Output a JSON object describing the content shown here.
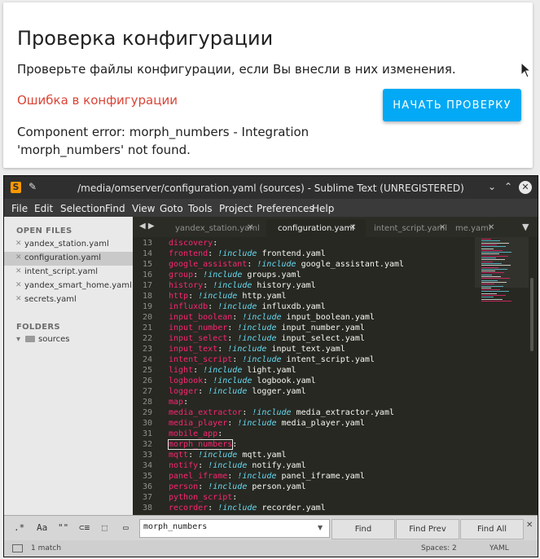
{
  "ha": {
    "title": "Проверка конфигурации",
    "description": "Проверьте файлы конфигурации, если Вы внесли в них изменения.",
    "error_title": "Ошибка в конфигурации",
    "error_message": "Component error: morph_numbers - Integration 'morph_numbers' not found.",
    "check_button": "НАЧАТЬ ПРОВЕРКУ"
  },
  "sublime": {
    "window_title": "/media/omserver/configuration.yaml (sources) - Sublime Text (UNREGISTERED)",
    "menu": [
      "File",
      "Edit",
      "Selection",
      "Find",
      "View",
      "Goto",
      "Tools",
      "Project",
      "Preferences",
      "Help"
    ],
    "sidebar": {
      "open_files_header": "OPEN FILES",
      "open_files": [
        "yandex_station.yaml",
        "configuration.yaml",
        "intent_script.yaml",
        "yandex_smart_home.yaml",
        "secrets.yaml"
      ],
      "active_file": "configuration.yaml",
      "folders_header": "FOLDERS",
      "folders": [
        "sources"
      ]
    },
    "tabs": [
      "yandex_station.yaml",
      "configuration.yaml",
      "intent_script.yaml",
      "me.yaml"
    ],
    "active_tab": "configuration.yaml",
    "lines": [
      {
        "n": "13",
        "key": "discovery",
        "inc": "",
        "val": ""
      },
      {
        "n": "14",
        "key": "frontend",
        "inc": "!include",
        "val": "frontend.yaml"
      },
      {
        "n": "15",
        "key": "google_assistant",
        "inc": "!include",
        "val": "google_assistant.yaml"
      },
      {
        "n": "16",
        "key": "group",
        "inc": "!include",
        "val": "groups.yaml"
      },
      {
        "n": "17",
        "key": "history",
        "inc": "!include",
        "val": "history.yaml"
      },
      {
        "n": "18",
        "key": "http",
        "inc": "!include",
        "val": "http.yaml"
      },
      {
        "n": "19",
        "key": "influxdb",
        "inc": "!include",
        "val": "influxdb.yaml"
      },
      {
        "n": "20",
        "key": "input_boolean",
        "inc": "!include",
        "val": "input_boolean.yaml"
      },
      {
        "n": "21",
        "key": "input_number",
        "inc": "!include",
        "val": "input_number.yaml"
      },
      {
        "n": "22",
        "key": "input_select",
        "inc": "!include",
        "val": "input_select.yaml"
      },
      {
        "n": "23",
        "key": "input_text",
        "inc": "!include",
        "val": "input_text.yaml"
      },
      {
        "n": "24",
        "key": "intent_script",
        "inc": "!include",
        "val": "intent_script.yaml"
      },
      {
        "n": "25",
        "key": "light",
        "inc": "!include",
        "val": "light.yaml"
      },
      {
        "n": "26",
        "key": "logbook",
        "inc": "!include",
        "val": "logbook.yaml"
      },
      {
        "n": "27",
        "key": "logger",
        "inc": "!include",
        "val": "logger.yaml"
      },
      {
        "n": "28",
        "key": "map",
        "inc": "",
        "val": ""
      },
      {
        "n": "29",
        "key": "media_extractor",
        "inc": "!include",
        "val": "media_extractor.yaml"
      },
      {
        "n": "30",
        "key": "media_player",
        "inc": "!include",
        "val": "media_player.yaml"
      },
      {
        "n": "31",
        "key": "mobile_app",
        "inc": "",
        "val": ""
      },
      {
        "n": "32",
        "key": "morph_numbers",
        "inc": "",
        "val": ""
      },
      {
        "n": "33",
        "key": "mqtt",
        "inc": "!include",
        "val": "mqtt.yaml"
      },
      {
        "n": "34",
        "key": "notify",
        "inc": "!include",
        "val": "notify.yaml"
      },
      {
        "n": "35",
        "key": "panel_iframe",
        "inc": "!include",
        "val": "panel_iframe.yaml"
      },
      {
        "n": "36",
        "key": "person",
        "inc": "!include",
        "val": "person.yaml"
      },
      {
        "n": "37",
        "key": "python_script",
        "inc": "",
        "val": ""
      },
      {
        "n": "38",
        "key": "recorder",
        "inc": "!include",
        "val": "recorder.yaml"
      }
    ],
    "highlighted_key": "morph_numbers",
    "find": {
      "options": [
        ".*",
        "Aa",
        "\"\"",
        "⊂≡",
        "⬚",
        "▭"
      ],
      "query": "morph_numbers",
      "find_label": "Find",
      "find_prev_label": "Find Prev",
      "find_all_label": "Find All"
    },
    "status": {
      "matches": "1 match",
      "spaces": "Spaces: 2",
      "syntax": "YAML"
    },
    "colors": {
      "key": "#f92672",
      "include": "#66d9ef",
      "value": "#f8f8f2",
      "background": "#272822"
    }
  }
}
